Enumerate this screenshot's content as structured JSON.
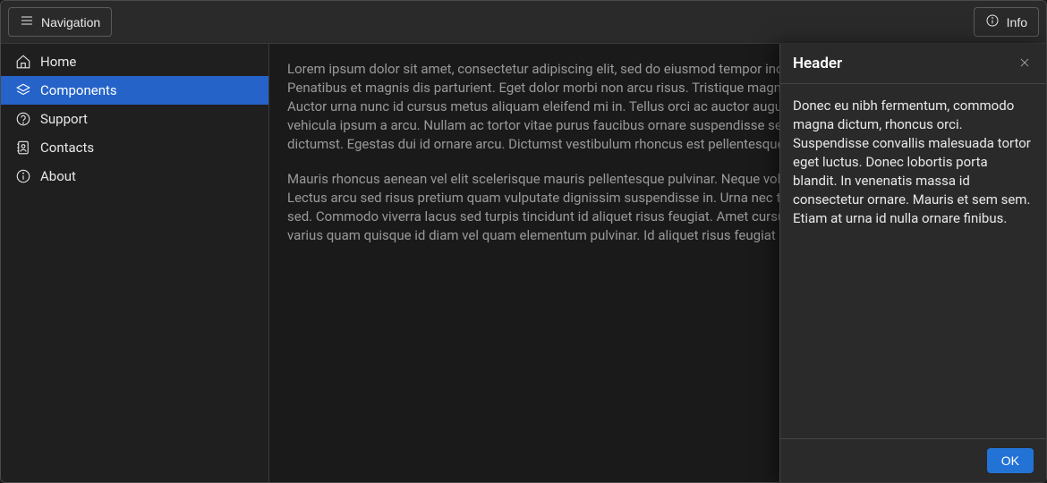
{
  "header": {
    "navigation_label": "Navigation",
    "info_label": "Info"
  },
  "sidebar": {
    "items": [
      {
        "label": "Home",
        "icon": "home-icon",
        "active": false
      },
      {
        "label": "Components",
        "icon": "layers-icon",
        "active": true
      },
      {
        "label": "Support",
        "icon": "support-icon",
        "active": false
      },
      {
        "label": "Contacts",
        "icon": "contacts-icon",
        "active": false
      },
      {
        "label": "About",
        "icon": "about-icon",
        "active": false
      }
    ]
  },
  "main": {
    "paragraphs": [
      "Lorem ipsum dolor sit amet, consectetur adipiscing elit, sed do eiusmod tempor incididunt ut labore et dolore magna aliqua. Penatibus et magnis dis parturient. Eget dolor morbi non arcu risus. Tristique magna sit amet purus gravida quis blandit. Auctor urna nunc id cursus metus aliquam eleifend mi in. Tellus orci ac auctor augue mauris augue neque gravida. Nullam vehicula ipsum a arcu. Nullam ac tortor vitae purus faucibus ornare suspendisse sed nisi. Cursus in hac habitasse platea dictumst. Egestas dui id ornare arcu. Dictumst vestibulum rhoncus est pellentesque elit ullamcorper dignissim.",
      "Mauris rhoncus aenean vel elit scelerisque mauris pellentesque pulvinar. Neque volutpat ac tincidunt vitae semper quis. Lectus arcu sed risus pretium quam vulputate dignissim suspendisse in. Urna nec tincidunt praesent semper feugiat nibh sed. Commodo viverra lacus sed turpis tincidunt id aliquet risus feugiat. Amet cursus sit amet dictum sit amet justo. Quis varius quam quisque id diam vel quam elementum pulvinar. Id aliquet risus feugiat in ante metus dictum at."
    ]
  },
  "info_panel": {
    "title": "Header",
    "body": "Donec eu nibh fermentum, commodo magna dictum, rhoncus orci. Suspendisse convallis malesuada tortor eget luctus. Donec lobortis porta blandit. In venenatis massa id consectetur ornare. Mauris et sem sem. Etiam at urna id nulla ornare finibus.",
    "ok_label": "OK"
  }
}
